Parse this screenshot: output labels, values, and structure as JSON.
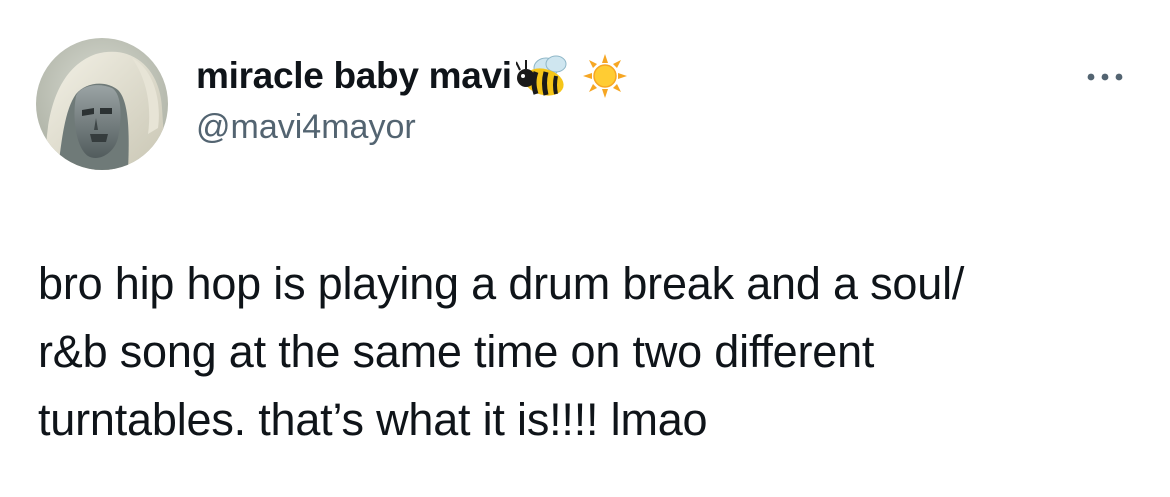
{
  "tweet": {
    "author": {
      "display_name": "miracle baby mavi",
      "handle": "@mavi4mayor",
      "avatar_icon": "masked-figure-avatar",
      "name_emojis": [
        "bee-emoji",
        "sun-emoji"
      ]
    },
    "more_icon": "more-horizontal-icon",
    "text_lines": [
      "bro hip hop is playing a drum break and a soul/",
      "r&b song at the same time on two different",
      "turntables. that’s what it is!!!! lmao"
    ]
  },
  "colors": {
    "text_primary": "#0f1419",
    "text_secondary": "#536471",
    "background": "#ffffff"
  }
}
